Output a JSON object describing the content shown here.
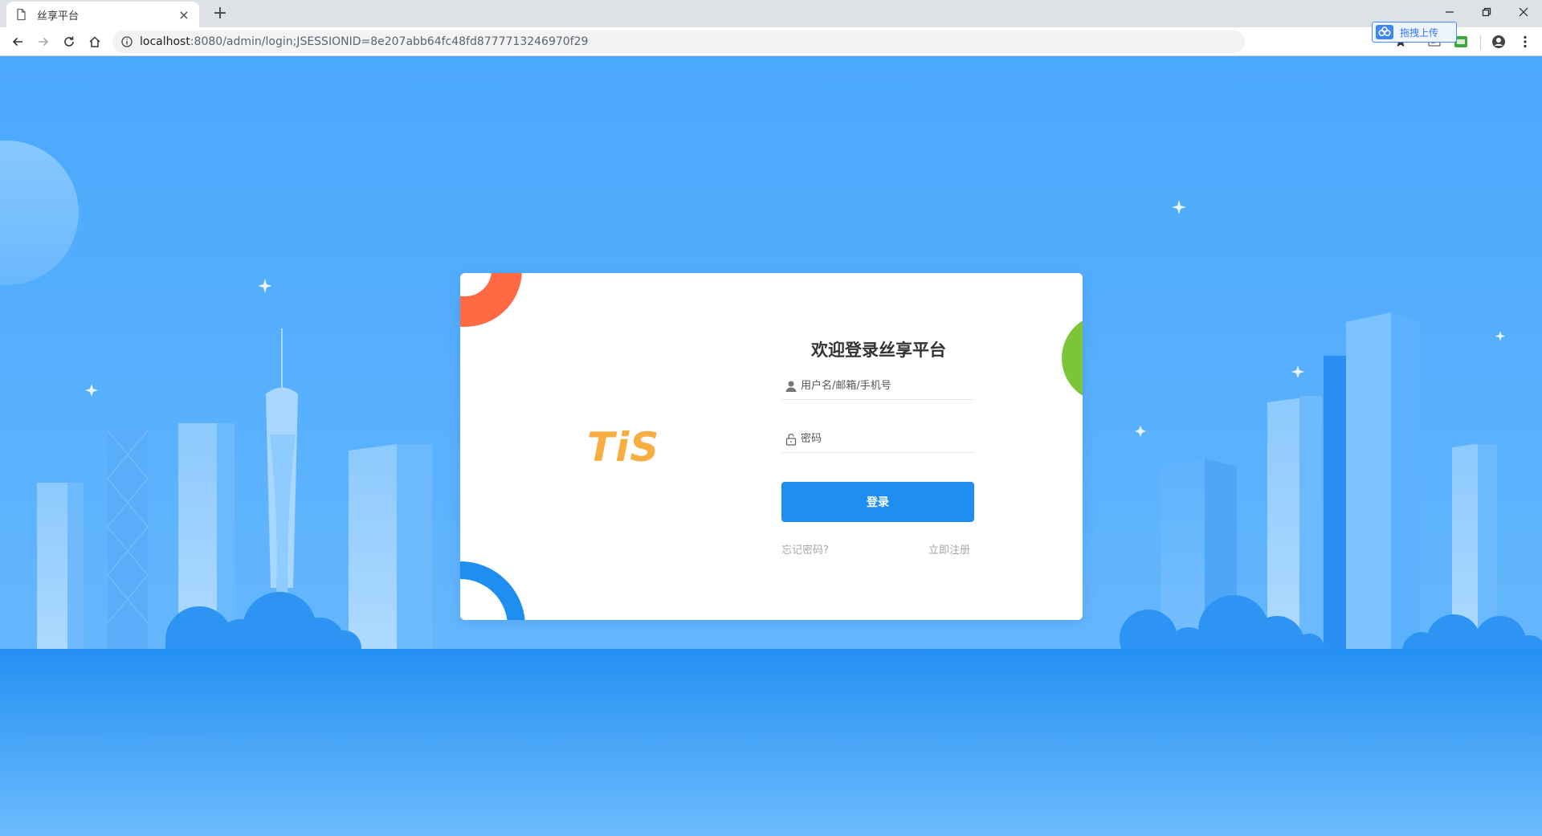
{
  "browser": {
    "tab_title": "丝享平台",
    "tab_close": "×",
    "new_tab": "+",
    "url_host": "localhost",
    "url_rest": ":8080/admin/login;JSESSIONID=8e207abb64fc48fd8777713246970f29",
    "baidu_popup_label": "拖拽上传",
    "icons": [
      "page-icon",
      "back-icon",
      "forward-icon",
      "reload-icon",
      "home-icon",
      "info-icon",
      "star-icon",
      "cast-icon",
      "extension-icon",
      "profile-icon",
      "menu-icon",
      "minimize-icon",
      "restore-icon",
      "close-icon"
    ]
  },
  "login": {
    "logo_text": "TiS",
    "title": "欢迎登录丝享平台",
    "username_placeholder": "用户名/邮箱/手机号",
    "password_placeholder": "密码",
    "submit_label": "登录",
    "forgot_label": "忘记密码?",
    "register_label": "立即注册"
  },
  "colors": {
    "sky": "#4aa9fb",
    "brand_blue": "#1e8ef0",
    "logo_orange": "#f8ae41",
    "deco_red": "#ff6a45",
    "deco_green": "#7cc53b"
  }
}
